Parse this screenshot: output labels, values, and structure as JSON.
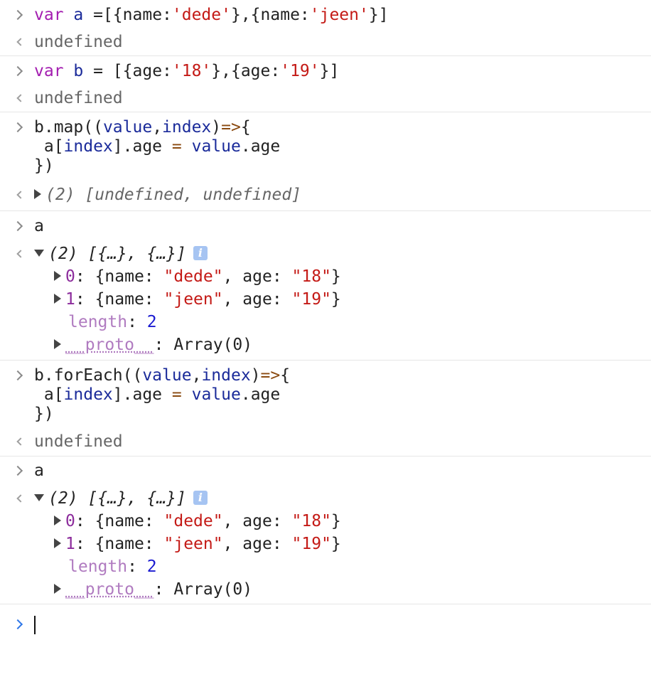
{
  "entries": [
    {
      "input": [
        "var a =[{name:'dede'},{name:'jeen'}]"
      ],
      "output": "undefined"
    },
    {
      "input": [
        "var b = [{age:'18'},{age:'19'}]"
      ],
      "output": "undefined"
    },
    {
      "input": [
        "b.map((value,index)=>{",
        " a[index].age = value.age",
        "})"
      ],
      "output": "(2) [undefined, undefined]"
    },
    {
      "input": [
        "a"
      ],
      "output_header": "(2) [{…}, {…}]",
      "items": [
        {
          "key": "0",
          "value": "{name: \"dede\", age: \"18\"}"
        },
        {
          "key": "1",
          "value": "{name: \"jeen\", age: \"19\"}"
        }
      ],
      "length_label": "length",
      "length_value": "2",
      "proto_label": "__proto__",
      "proto_value": "Array(0)"
    },
    {
      "input": [
        "b.forEach((value,index)=>{",
        " a[index].age = value.age",
        "})"
      ],
      "output": "undefined"
    },
    {
      "input": [
        "a"
      ],
      "output_header": "(2) [{…}, {…}]",
      "items": [
        {
          "key": "0",
          "value": "{name: \"dede\", age: \"18\"}"
        },
        {
          "key": "1",
          "value": "{name: \"jeen\", age: \"19\"}"
        }
      ],
      "length_label": "length",
      "length_value": "2",
      "proto_label": "__proto__",
      "proto_value": "Array(0)"
    }
  ],
  "prompt": {
    "value": ""
  },
  "colors": {
    "keyword": "#a31db0",
    "variable": "#1b2b9a",
    "string": "#c41a16",
    "prompt": "#2f77e8",
    "info_badge": "#a6c4f2"
  },
  "icons": [
    "input-chevron-icon",
    "output-arrow-icon",
    "expand-triangle-icon",
    "info-icon"
  ]
}
